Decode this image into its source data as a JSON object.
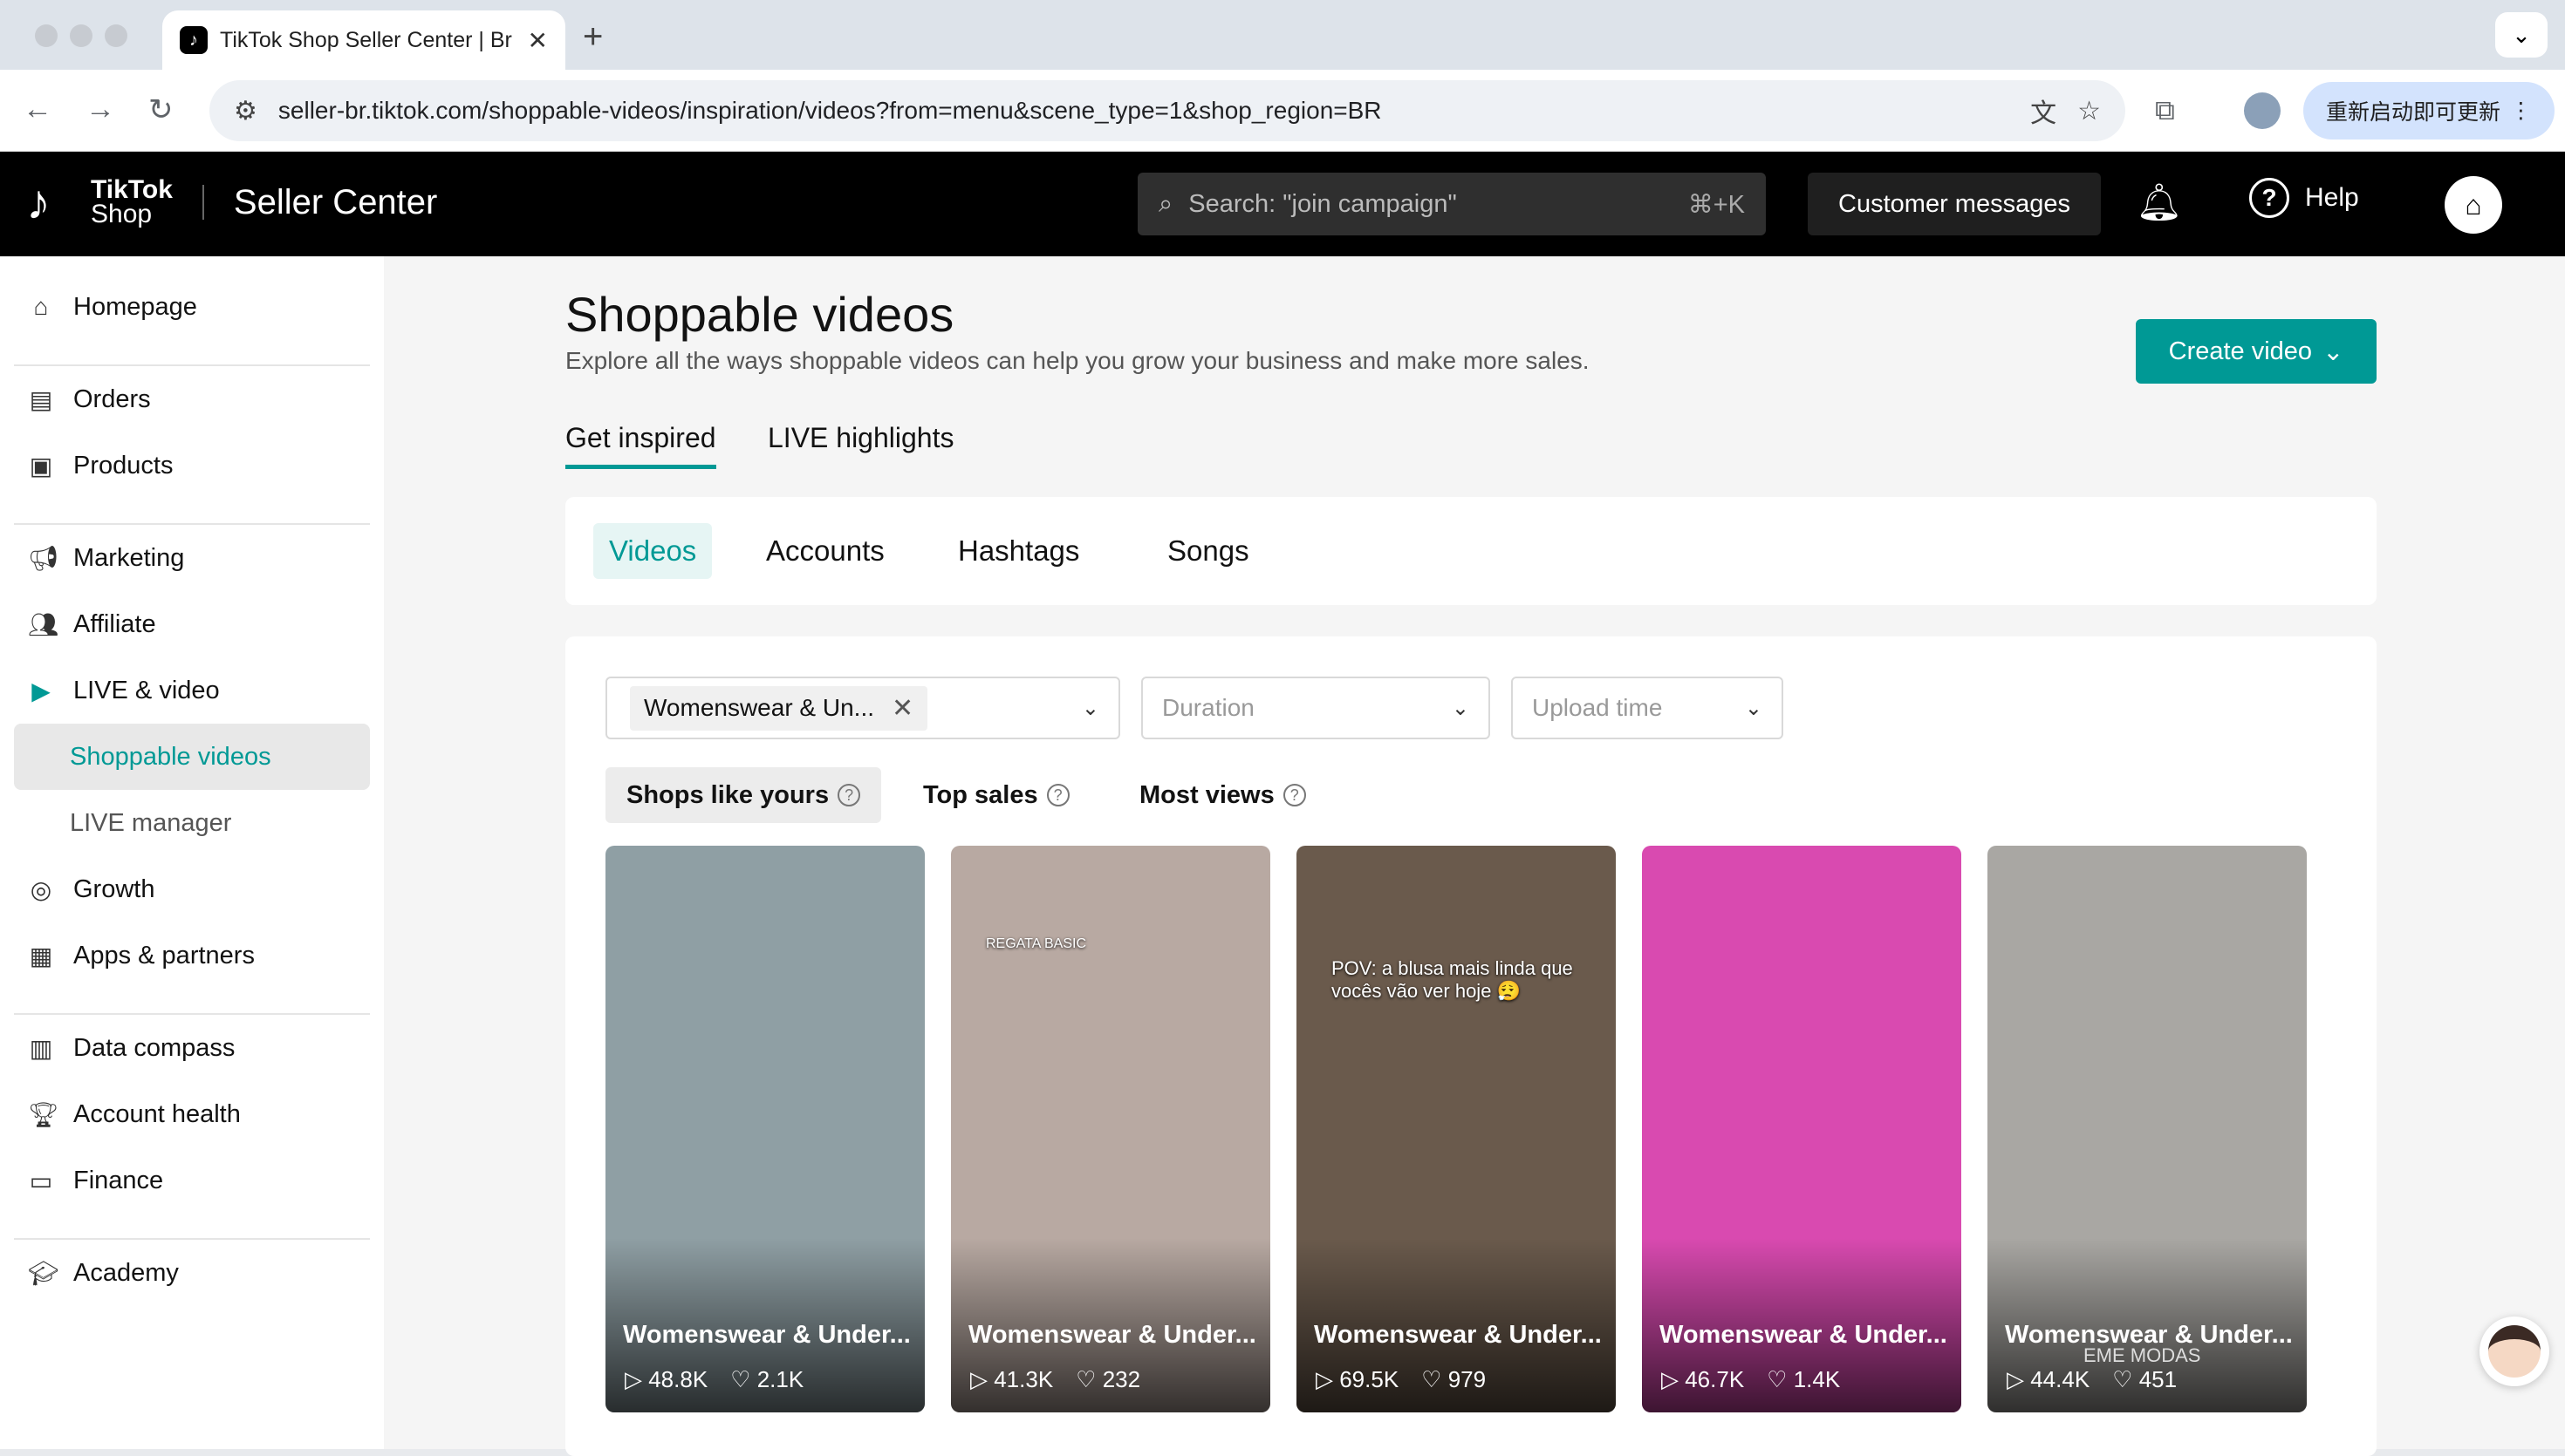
{
  "browser": {
    "tab_title": "TikTok Shop Seller Center | Br",
    "url": "seller-br.tiktok.com/shoppable-videos/inspiration/videos?from=menu&scene_type=1&shop_region=BR",
    "update_label": "重新启动即可更新"
  },
  "header": {
    "logo_line1": "TikTok",
    "logo_line2": "Shop",
    "title": "Seller Center",
    "search_placeholder": "Search: \"join campaign\"",
    "search_shortcut": "⌘+K",
    "customer_messages": "Customer messages",
    "help": "Help"
  },
  "sidebar": {
    "items": [
      {
        "label": "Homepage",
        "icon": "home-icon"
      },
      {
        "label": "Orders",
        "icon": "clipboard-icon"
      },
      {
        "label": "Products",
        "icon": "bag-icon"
      },
      {
        "label": "Marketing",
        "icon": "megaphone-icon"
      },
      {
        "label": "Affiliate",
        "icon": "people-icon"
      },
      {
        "label": "LIVE & video",
        "icon": "video-icon"
      },
      {
        "label": "Shoppable videos"
      },
      {
        "label": "LIVE manager"
      },
      {
        "label": "Growth",
        "icon": "medal-icon"
      },
      {
        "label": "Apps & partners",
        "icon": "grid-icon"
      },
      {
        "label": "Data compass",
        "icon": "bar-chart-icon"
      },
      {
        "label": "Account health",
        "icon": "trophy-icon"
      },
      {
        "label": "Finance",
        "icon": "wallet-icon"
      },
      {
        "label": "Academy",
        "icon": "graduation-cap-icon"
      }
    ]
  },
  "page": {
    "title": "Shoppable videos",
    "subtitle": "Explore all the ways shoppable videos can help you grow your business and make more sales.",
    "create_button": "Create video",
    "main_tabs": [
      "Get inspired",
      "LIVE highlights"
    ],
    "sub_tabs": [
      "Videos",
      "Accounts",
      "Hashtags",
      "Songs"
    ],
    "filters": {
      "category_chip": "Womenswear & Un...",
      "duration_placeholder": "Duration",
      "upload_placeholder": "Upload time"
    },
    "sorts": [
      "Shops like yours",
      "Top sales",
      "Most views"
    ],
    "videos": [
      {
        "category": "Womenswear & Under...",
        "views": "48.8K",
        "likes": "2.1K",
        "bg": "#8f9fa4",
        "overlay": ""
      },
      {
        "category": "Womenswear & Under...",
        "views": "41.3K",
        "likes": "232",
        "bg": "#b8a9a2",
        "overlay": "REGATA BASIC"
      },
      {
        "category": "Womenswear & Under...",
        "views": "69.5K",
        "likes": "979",
        "bg": "#6a5a4c",
        "overlay": "POV: a blusa mais linda que vocês vão ver hoje 😮‍💨"
      },
      {
        "category": "Womenswear & Under...",
        "views": "46.7K",
        "likes": "1.4K",
        "bg": "#d94ab0",
        "overlay": ""
      },
      {
        "category": "Womenswear & Under...",
        "views": "44.4K",
        "likes": "451",
        "bg": "#a9a7a3",
        "overlay": "",
        "watermark": "EME MODAS"
      }
    ]
  },
  "colors": {
    "accent": "#009995",
    "topbar": "#000000"
  }
}
